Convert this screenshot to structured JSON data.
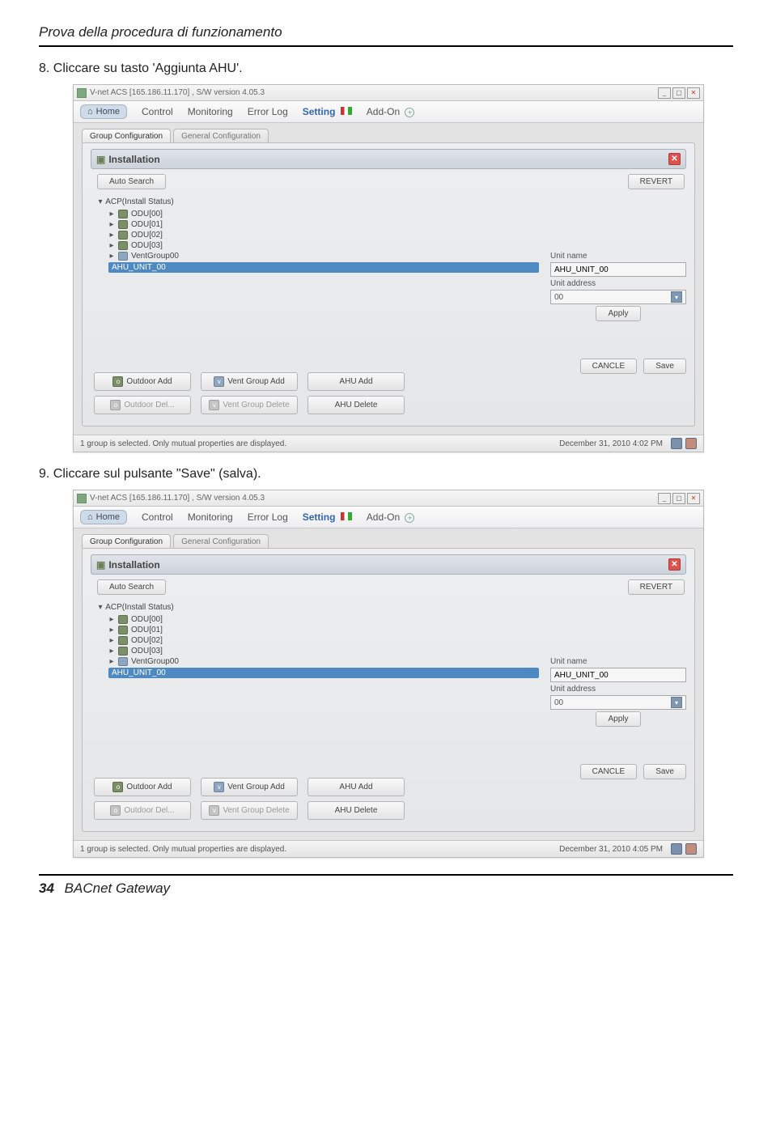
{
  "doc": {
    "header": "Prova della procedura di funzionamento",
    "step8": "8. Cliccare su tasto 'Aggiunta AHU'.",
    "step9": "9. Cliccare sul pulsante \"Save\" (salva).",
    "page_no": "34",
    "doc_name": "BACnet Gateway"
  },
  "app": {
    "title": "V-net ACS  [165.186.11.170] ,   S/W version 4.05.3",
    "home": "Home",
    "menu": {
      "control": "Control",
      "monitoring": "Monitoring",
      "errorlog": "Error Log",
      "setting": "Setting",
      "addon": "Add-On"
    },
    "tabs": {
      "group": "Group Configuration",
      "general": "General Configuration"
    },
    "panel_title": "Installation",
    "auto_search": "Auto Search",
    "revert": "REVERT",
    "tree": {
      "root": "ACP(Install Status)",
      "odu0": "ODU[00]",
      "odu1": "ODU[01]",
      "odu2": "ODU[02]",
      "odu3": "ODU[03]",
      "vent": "VentGroup00",
      "ahu": "AHU_UNIT_00"
    },
    "buttons": {
      "outdoor_add": "Outdoor Add",
      "vent_group_add": "Vent Group Add",
      "ahu_add": "AHU Add",
      "outdoor_del": "Outdoor Del...",
      "vent_group_del": "Vent Group Delete",
      "ahu_del": "AHU Delete",
      "cancle": "CANCLE",
      "save": "Save",
      "apply": "Apply"
    },
    "form": {
      "unit_name_lbl": "Unit name",
      "unit_name_val": "AHU_UNIT_00",
      "unit_addr_lbl": "Unit address",
      "unit_addr_val": "00"
    },
    "status": {
      "left": "1 group is selected. Only mutual properties are displayed.",
      "time1": "December 31, 2010  4:02 PM",
      "time2": "December 31, 2010  4:05 PM"
    }
  }
}
